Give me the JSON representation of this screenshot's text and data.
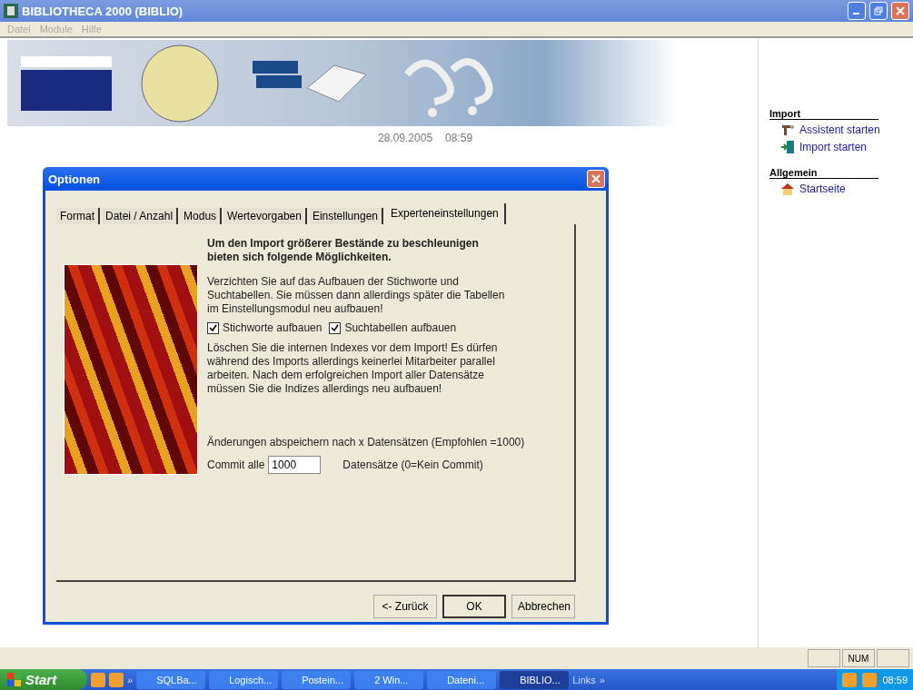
{
  "window": {
    "title": "BIBLIOTHECA 2000 (BIBLIO)"
  },
  "menu": [
    {
      "label": "Datei",
      "disabled": true
    },
    {
      "label": "Module",
      "disabled": true
    },
    {
      "label": "Hilfe",
      "disabled": true
    }
  ],
  "header": {
    "date": "28.09.2005",
    "time": "08:59"
  },
  "sidebar": [
    {
      "title": "Import",
      "items": [
        {
          "label": "Assistent starten",
          "kind": "wizard"
        },
        {
          "label": "Import starten",
          "kind": "import"
        }
      ]
    },
    {
      "title": "Allgemein",
      "items": [
        {
          "label": "Startseite",
          "kind": "home"
        }
      ]
    }
  ],
  "dialog": {
    "title": "Optionen",
    "tabs": [
      {
        "label": "Format",
        "selected": false
      },
      {
        "label": "Datei / Anzahl",
        "selected": false
      },
      {
        "label": "Modus",
        "selected": false
      },
      {
        "label": "Wertevorgaben",
        "selected": false
      },
      {
        "label": "Einstellungen",
        "selected": false
      },
      {
        "label": "Experteneinstellungen",
        "selected": true
      }
    ],
    "heading": "Um den Import größerer Bestände zu beschleunigen bieten sich folgende Möglichkeiten.",
    "paragraph1": "Verzichten Sie auf das Aufbauen der Stichworte und Suchtabellen. Sie müssen dann allerdings später die Tabellen im Einstellungsmodul neu aufbauen!",
    "checkboxes": [
      {
        "label": "Stichworte aufbauen",
        "checked": true
      },
      {
        "label": "Suchtabellen aufbauen",
        "checked": true
      }
    ],
    "paragraph2": "Löschen Sie die internen Indexes vor dem Import! Es dürfen während des Imports allerdings keinerlei Mitarbeiter parallel arbeiten. Nach dem erfolgreichen Import aller Datensätze müssen Sie die Indizes allerdings neu aufbauen!",
    "commit_hint": "Änderungen abspeichern nach x Datensätzen (Empfohlen =1000)",
    "commit_label": "Commit alle",
    "commit_value": "1000",
    "commit_suffix": "Datensätze (0=Kein Commit)",
    "buttons": [
      {
        "label": "<- Zurück",
        "default": false
      },
      {
        "label": "OK",
        "default": true
      },
      {
        "label": "Abbrechen",
        "default": false
      }
    ]
  },
  "status_bar": {
    "indicator": "NUM"
  },
  "taskbar": {
    "start": "Start",
    "more": "»",
    "tasks": [
      {
        "label": "SQLBa...",
        "selected": false
      },
      {
        "label": "Logisch...",
        "selected": false
      },
      {
        "label": "Postein...",
        "selected": false
      },
      {
        "label": "2 Win...",
        "selected": false
      },
      {
        "label": "Dateni...",
        "selected": false
      },
      {
        "label": "BIBLIO...",
        "selected": true
      }
    ],
    "links": "Links",
    "links_more": "»",
    "clock": "08:59"
  }
}
